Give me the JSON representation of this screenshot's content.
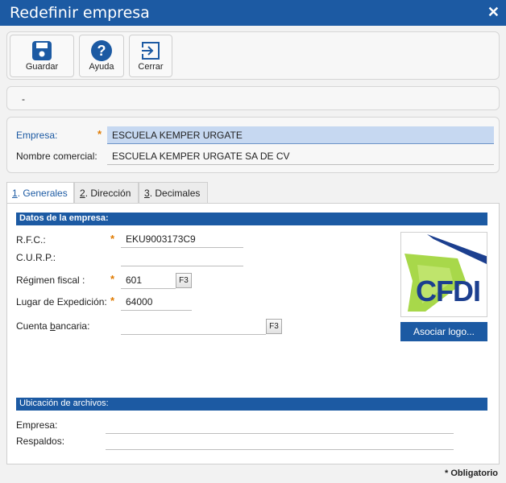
{
  "window": {
    "title": "Redefinir empresa"
  },
  "toolbar": {
    "save_label": "Guardar",
    "help_label": "Ayuda",
    "close_label": "Cerrar"
  },
  "status": {
    "text": "-"
  },
  "header": {
    "empresa_label": "Empresa:",
    "empresa_value": "ESCUELA KEMPER URGATE",
    "nombre_label": "Nombre comercial:",
    "nombre_value": "ESCUELA KEMPER URGATE SA DE CV",
    "required_mark": "*"
  },
  "tabs": [
    {
      "key": "1",
      "label": ". Generales"
    },
    {
      "key": "2",
      "label": ". Dirección"
    },
    {
      "key": "3",
      "label": ". Decimales"
    }
  ],
  "datos": {
    "section_title": "Datos de la empresa:",
    "rfc_label": "R.F.C.:",
    "rfc_value": "EKU9003173C9",
    "curp_label": "C.U.R.P.:",
    "curp_value": "",
    "regimen_label": "Régimen fiscal :",
    "regimen_value": "601",
    "lugar_label": "Lugar de Expedición:",
    "lugar_value": "64000",
    "cuenta_label": "Cuenta bancaria:",
    "cuenta_value": "",
    "f3_label": "F3",
    "logo_text": "CFDI",
    "assoc_logo_label": "Asociar logo..."
  },
  "archivos": {
    "section_title": "Ubicación de archivos:",
    "empresa_label": "Empresa:",
    "empresa_value": "",
    "respaldos_label": "Respaldos:",
    "respaldos_value": ""
  },
  "footer": {
    "required_note": "* Obligatorio"
  },
  "colors": {
    "accent": "#1c5aa3",
    "required": "#e07a00",
    "active_field": "#c6d8f1"
  }
}
